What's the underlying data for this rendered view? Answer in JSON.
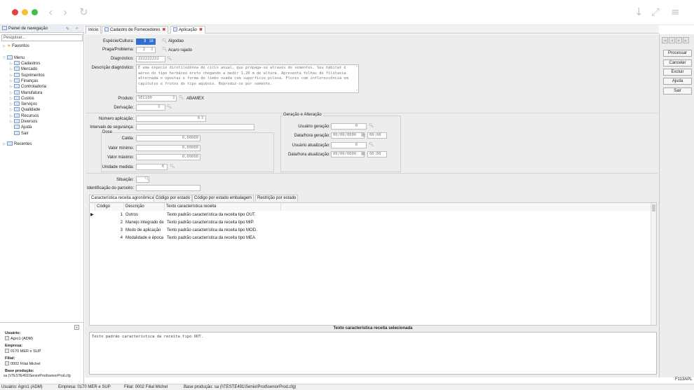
{
  "navigation": {
    "title": "Painel de navegação",
    "search_placeholder": "Pesquisar...",
    "favorites": "Favoritos",
    "menu": "Menu",
    "menu_items": [
      "Cadastros",
      "Mercado",
      "Suprimentos",
      "Finanças",
      "Controladoria",
      "Manufatura",
      "Custos",
      "Serviços",
      "Qualidade",
      "Recursos",
      "Diversos",
      "Ajuda",
      "Sair"
    ],
    "recent": "Recentes",
    "footer": {
      "user_label": "Usuário:",
      "user_value": "Agro1 (ADM)",
      "company_label": "Empresa:",
      "company_value": "0170 MER e SUP",
      "branch_label": "Filial:",
      "branch_value": "0002 Filial Michel",
      "db_label": "Base produção:",
      "db_value": "sa (\\\\TESTE491\\SeniorProd\\seniorProd.cfg"
    }
  },
  "tabs": [
    {
      "label": "Início"
    },
    {
      "label": "Cadastro de Fornecedores"
    },
    {
      "label": "Aplicação"
    }
  ],
  "form": {
    "especie_label": "Espécie/Cultura:",
    "especie_code": "16",
    "especie_desc": "Algodao",
    "praga_label": "Praga/Problema:",
    "praga_code": "2",
    "praga_desc": "Acaro rajado",
    "diagnostico_label": "Diagnóstico:",
    "diagnostico_value": "222222222",
    "descricao_label": "Descrição diagnóstico:",
    "descricao_value": "É uma espécie dicotiledônea de ciclo anual, que propaga-se através de sementes. Seu hábitat é aéreo do tipo herbáceo ereto chegando a medir 1,20 m de altura. Apresenta folhas de filotaxia alternada e opostas e forma do limbo ovada com superfície pilosa. Flores com inflorescência em capítulos e frutos do tipo aquênio. Reproduz-se por semente.",
    "produto_label": "Produto:",
    "produto_code": "SEC100",
    "produto_desc": "ABAMEX",
    "derivacao_label": "Derivação:",
    "numero_label": "Número aplicação:",
    "numero_value": "0",
    "intervalo_label": "Intervalo de segurança:",
    "dose_title": "Dose",
    "calda_label": "Calda:",
    "calda_value": "0,00000",
    "min_label": "Valor mínimo:",
    "min_value": "0,00000",
    "max_label": "Valor máximo:",
    "max_value": "0,00000",
    "unidade_label": "Unidade medida:",
    "unidade_value": "0",
    "situacao_label": "Situação:",
    "identificacao_label": "Identificação do parceiro:",
    "geracao_title": "Geração e Alteração",
    "usuario_geracao_label": "Usuário geração:",
    "usuario_geracao_value": "0",
    "data_geracao_label": "Data/hora geração:",
    "data_geracao_value": "00/00/0000",
    "hora_geracao_value": "00:00",
    "usuario_atualizacao_label": "Usuário atualização:",
    "usuario_atualizacao_value": "0",
    "data_atualizacao_label": "Data/hora atualização:",
    "data_atualizacao_value": "00/00/0000",
    "hora_atualizacao_value": "00:00"
  },
  "subtabs": [
    {
      "label": "Característica receita agronômica"
    },
    {
      "label": "Código por estado"
    },
    {
      "label": "Código por estado embalagem"
    },
    {
      "label": "Restrição por estado"
    }
  ],
  "grid": {
    "headers": [
      "Código",
      "Descrição",
      "Texto característica receita"
    ],
    "rows": [
      {
        "code": "1",
        "desc": "Outros",
        "text": "Texto padrão característica da receita tipo OUT."
      },
      {
        "code": "2",
        "desc": "Manejo integrado de",
        "text": "Texto padrão característica da receita tipo MIP."
      },
      {
        "code": "3",
        "desc": "Modo de aplicação",
        "text": "Texto padrão característica da receita tipo MOD."
      },
      {
        "code": "4",
        "desc": "Modalidade e época",
        "text": "Texto padrão característica da receita tipo MEA."
      }
    ],
    "selected_title": "Texto característica receita selecionada",
    "selected_text": "Texto padrão característica da receita tipo OUT."
  },
  "actions": {
    "processar": "Processar",
    "cancelar": "Cancelar",
    "excluir": "Excluir",
    "ajuda": "Ajuda",
    "sair": "Sair"
  },
  "screen_code": "F113APL",
  "status": {
    "usuario": "Usuário: Agro1 (ADM)",
    "empresa": "Empresa: 0170 MER e SUP",
    "filial": "Filial: 0002 Filial Michel",
    "base": "Base produção: sa (\\\\TESTE491\\SeniorProd\\seniorProd.cfg)"
  },
  "colors": {
    "close": "#e8413b",
    "minimize": "#f5c12e",
    "maximize": "#3bbf4f",
    "tab_close": "#c0392b"
  }
}
